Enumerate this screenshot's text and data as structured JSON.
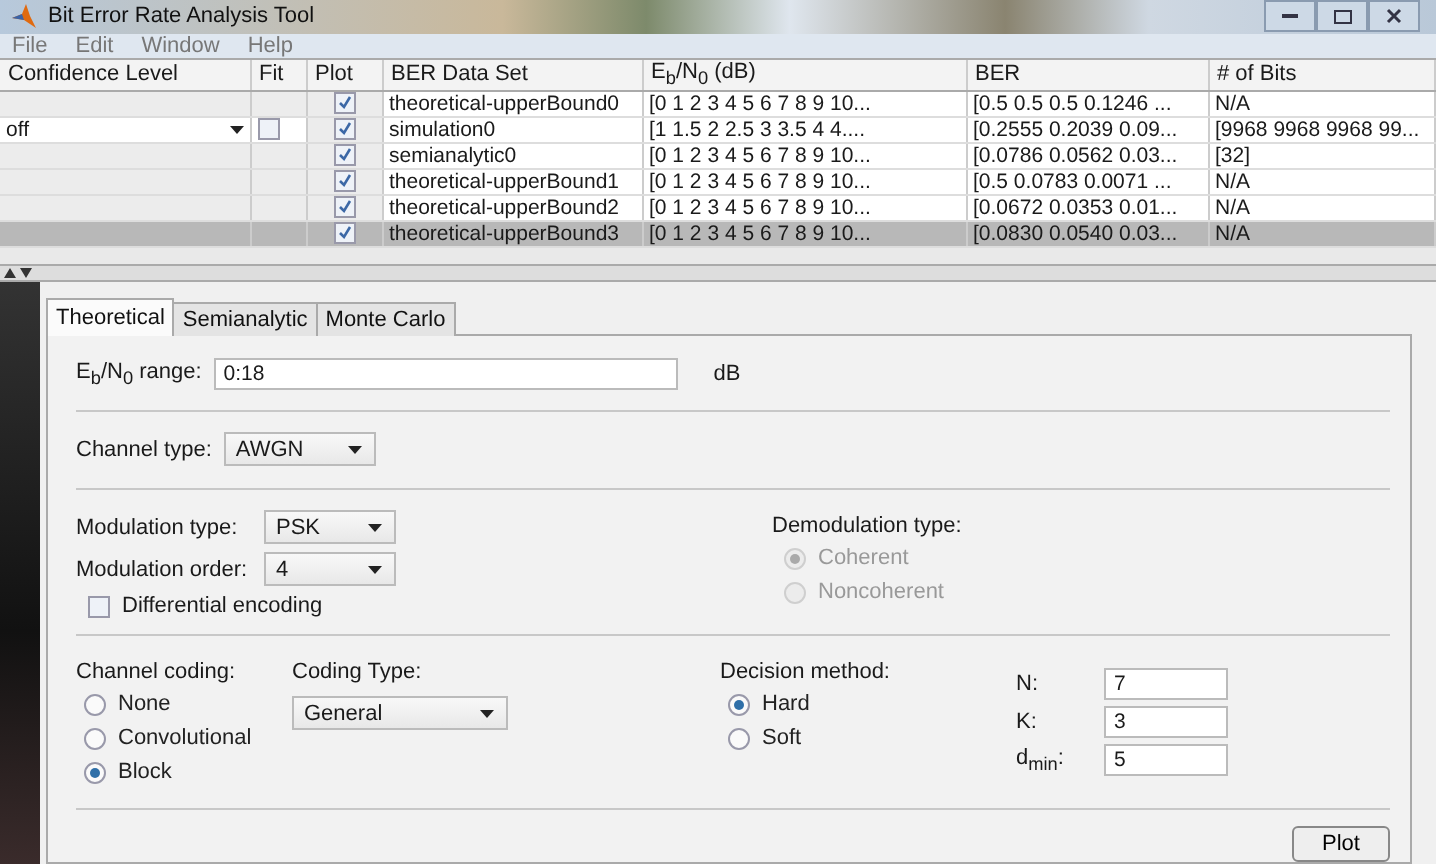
{
  "window": {
    "title": "Bit Error Rate Analysis Tool"
  },
  "menu": [
    "File",
    "Edit",
    "Window",
    "Help"
  ],
  "table": {
    "columns": [
      "Confidence Level",
      "Fit",
      "Plot",
      "BER Data Set",
      "E$_{b}$/N$_{0}$ (dB)",
      "BER",
      "# of Bits"
    ],
    "rows": [
      {
        "kind": "plain",
        "plot": true,
        "dataset": "theoretical-upperBound0",
        "ebno": "[0 1 2 3 4 5 6 7 8 9 10...",
        "ber": "[0.5  0.5  0.5  0.1246  ...",
        "bits": "N/A",
        "selected": false
      },
      {
        "kind": "simulation",
        "confidence": "off",
        "fit": false,
        "plot": true,
        "dataset": "simulation0",
        "ebno": "[1 1.5 2 2.5 3 3.5 4 4....",
        "ber": "[0.2555  0.2039  0.09...",
        "bits": "[9968  9968  9968  99...",
        "selected": false
      },
      {
        "kind": "plain",
        "plot": true,
        "dataset": "semianalytic0",
        "ebno": "[0 1 2 3 4 5 6 7 8 9 10...",
        "ber": "[0.0786  0.0562  0.03...",
        "bits": "[32]",
        "selected": false
      },
      {
        "kind": "plain",
        "plot": true,
        "dataset": "theoretical-upperBound1",
        "ebno": "[0 1 2 3 4 5 6 7 8 9 10...",
        "ber": "[0.5  0.0783  0.0071  ...",
        "bits": "N/A",
        "selected": false
      },
      {
        "kind": "plain",
        "plot": true,
        "dataset": "theoretical-upperBound2",
        "ebno": "[0 1 2 3 4 5 6 7 8 9 10...",
        "ber": "[0.0672  0.0353  0.01...",
        "bits": "N/A",
        "selected": false
      },
      {
        "kind": "plain",
        "plot": true,
        "dataset": "theoretical-upperBound3",
        "ebno": "[0 1 2 3 4 5 6 7 8 9 10...",
        "ber": "[0.0830  0.0540  0.03...",
        "bits": "N/A",
        "selected": true
      }
    ]
  },
  "tabs": [
    {
      "label": "Theoretical",
      "selected": true
    },
    {
      "label": "Semianalytic",
      "selected": false
    },
    {
      "label": "Monte Carlo",
      "selected": false
    }
  ],
  "eb_no_range": {
    "label": "E$_{b}$/N$_{0}$ range:",
    "value": "0:18",
    "unit": "dB"
  },
  "channel_type": {
    "label": "Channel type:",
    "value": "AWGN"
  },
  "modulation_type": {
    "label": "Modulation type:",
    "value": "PSK"
  },
  "modulation_order": {
    "label": "Modulation order:",
    "value": "4"
  },
  "differential_encoding": {
    "label": "Differential encoding",
    "checked": false
  },
  "demodulation": {
    "label": "Demodulation type:",
    "options": [
      {
        "label": "Coherent",
        "selected": true,
        "disabled": true
      },
      {
        "label": "Noncoherent",
        "selected": false,
        "disabled": true
      }
    ]
  },
  "channel_coding": {
    "label": "Channel coding:",
    "options": [
      {
        "label": "None",
        "selected": false,
        "disabled": false
      },
      {
        "label": "Convolutional",
        "selected": false,
        "disabled": false
      },
      {
        "label": "Block",
        "selected": true,
        "disabled": false
      }
    ]
  },
  "coding_type": {
    "label": "Coding Type:",
    "value": "General"
  },
  "decision_method": {
    "label": "Decision method:",
    "options": [
      {
        "label": "Hard",
        "selected": true,
        "disabled": false
      },
      {
        "label": "Soft",
        "selected": false,
        "disabled": false
      }
    ]
  },
  "block_params": [
    {
      "label": "N:",
      "value": "7"
    },
    {
      "label": "K:",
      "value": "3"
    },
    {
      "label": "d$_{min}$:",
      "value": "5"
    }
  ],
  "plot_button": "Plot"
}
